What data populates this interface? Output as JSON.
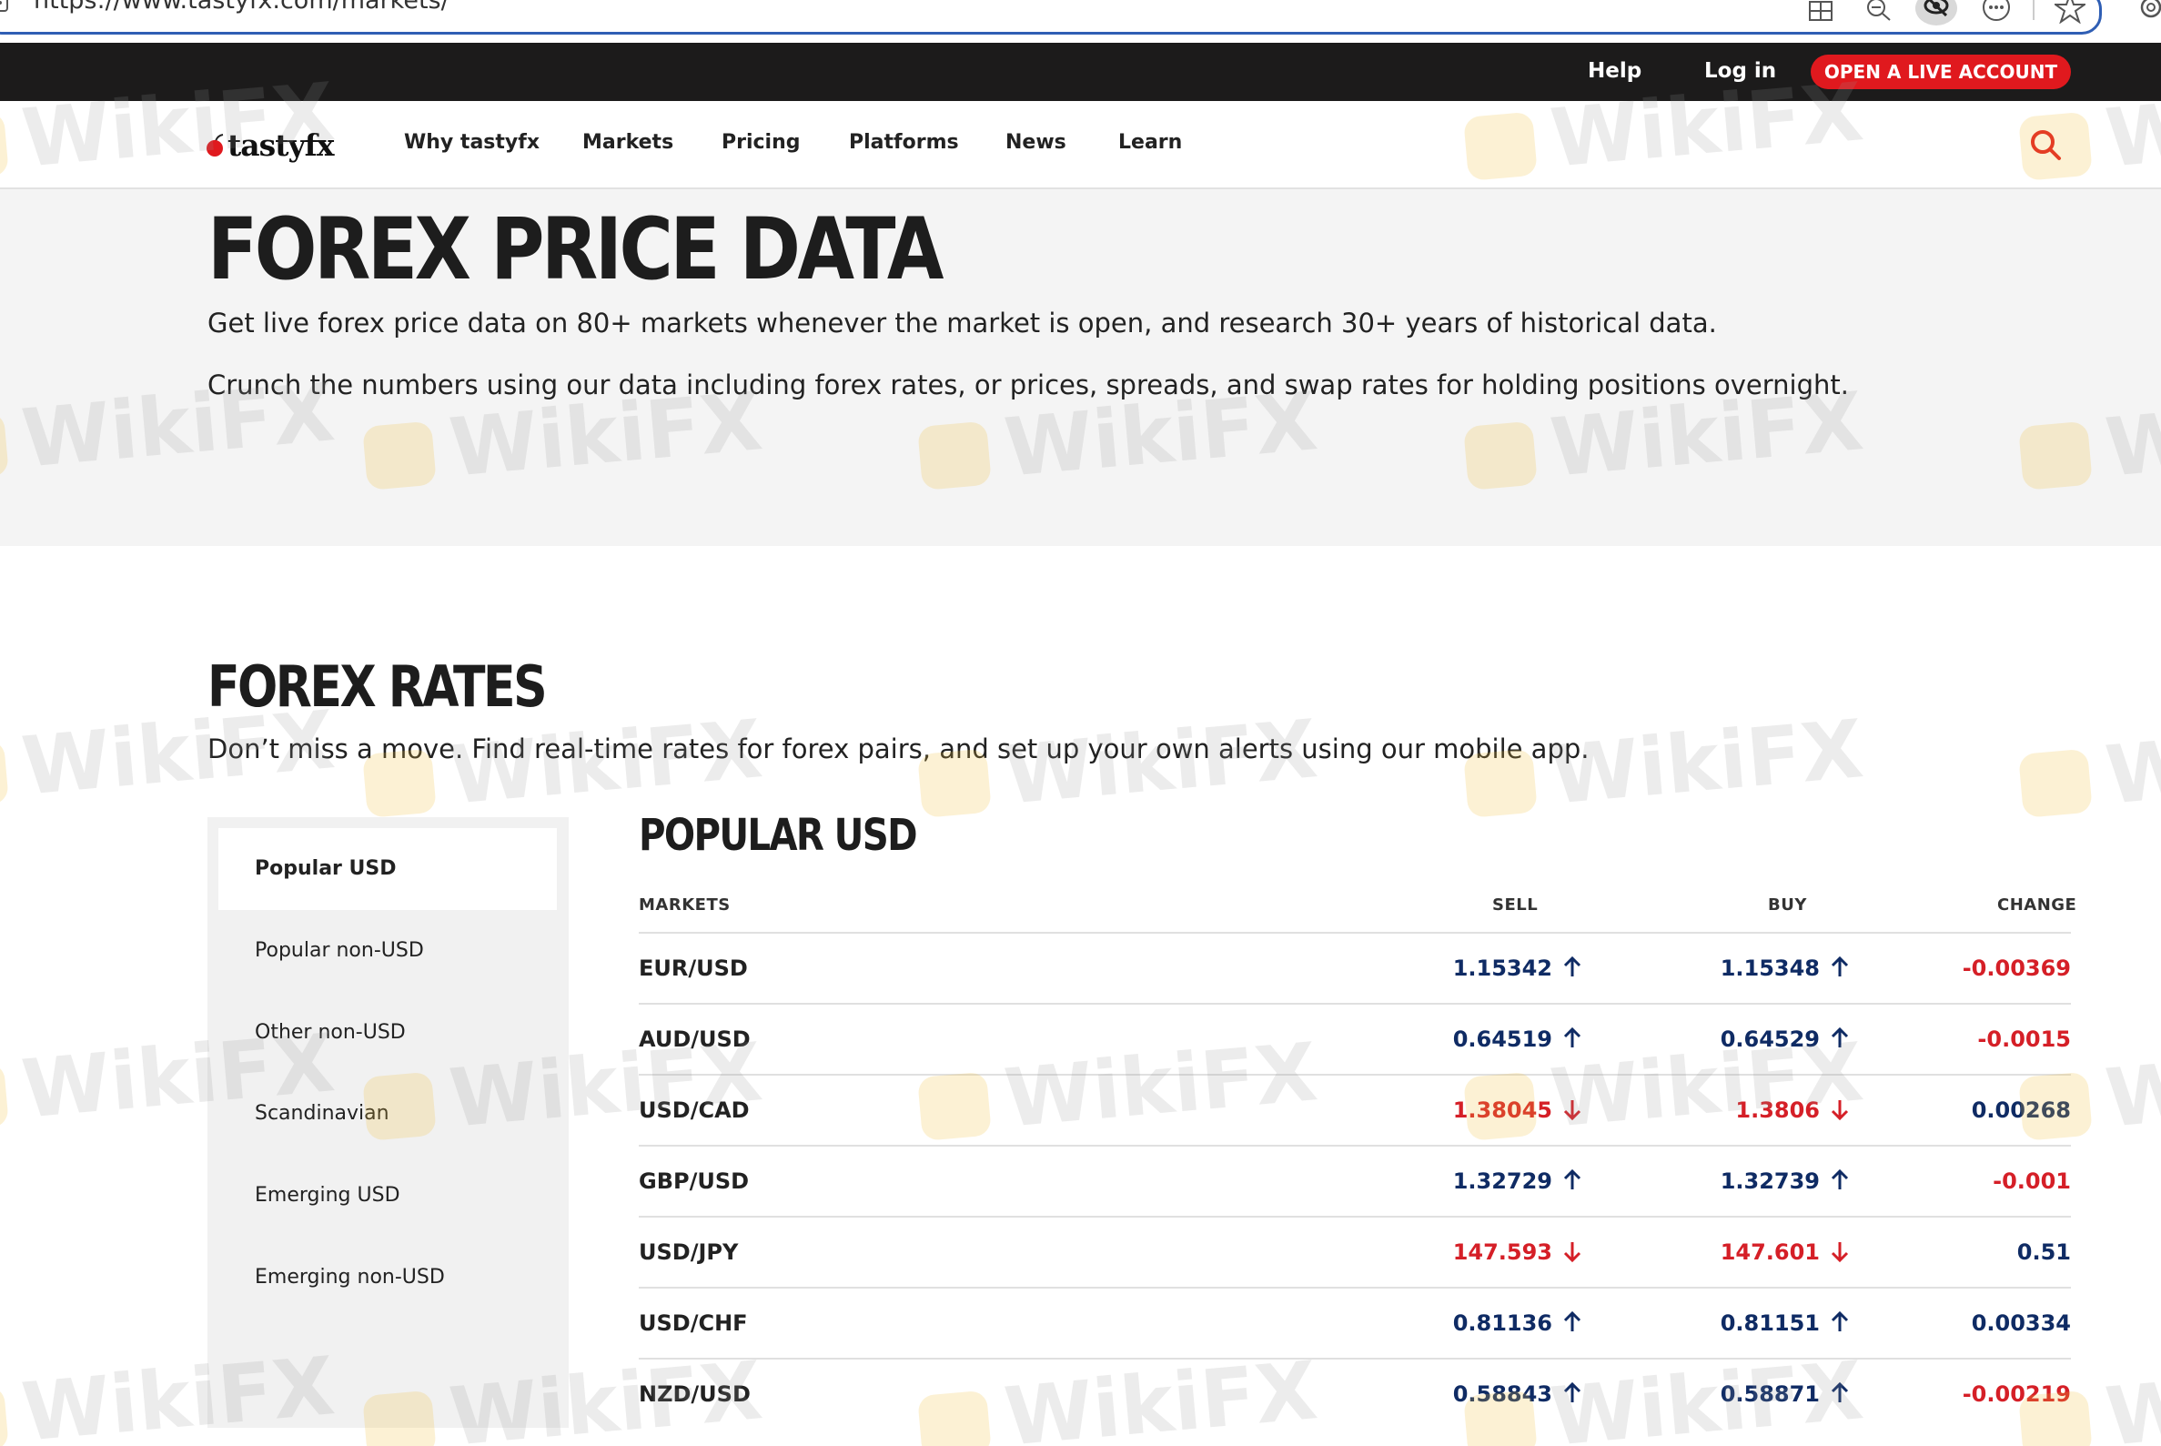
{
  "browser": {
    "url": "https://www.tastyfx.com/markets/"
  },
  "top_strip": {
    "help": "Help",
    "login": "Log in",
    "cta": "OPEN A LIVE ACCOUNT"
  },
  "nav": {
    "logo": "tastyfx",
    "items": [
      "Why tastyfx",
      "Markets",
      "Pricing",
      "Platforms",
      "News",
      "Learn"
    ]
  },
  "hero": {
    "title": "FOREX PRICE DATA",
    "p1": "Get live forex price data on 80+ markets whenever the market is open, and research 30+ years of historical data.",
    "p2": "Crunch the numbers using our data including forex rates, or prices, spreads, and swap rates for holding positions overnight."
  },
  "rates": {
    "title": "FOREX RATES",
    "subtitle": "Don’t miss a move. Find real-time rates for forex pairs, and set up your own alerts using our mobile app."
  },
  "sidebar": {
    "items": [
      "Popular USD",
      "Popular non-USD",
      "Other non-USD",
      "Scandinavian",
      "Emerging USD",
      "Emerging non-USD"
    ]
  },
  "table": {
    "title": "POPULAR USD",
    "headers": {
      "markets": "MARKETS",
      "sell": "SELL",
      "buy": "BUY",
      "change": "CHANGE"
    },
    "rows": [
      {
        "market": "EUR/USD",
        "sell": "1.15342",
        "buy": "1.15348",
        "change": "-0.00369",
        "direction": "up",
        "change_dir": "neg"
      },
      {
        "market": "AUD/USD",
        "sell": "0.64519",
        "buy": "0.64529",
        "change": "-0.0015",
        "direction": "up",
        "change_dir": "neg"
      },
      {
        "market": "USD/CAD",
        "sell": "1.38045",
        "buy": "1.3806",
        "change": "0.00268",
        "direction": "down",
        "change_dir": "pos"
      },
      {
        "market": "GBP/USD",
        "sell": "1.32729",
        "buy": "1.32739",
        "change": "-0.001",
        "direction": "up",
        "change_dir": "neg"
      },
      {
        "market": "USD/JPY",
        "sell": "147.593",
        "buy": "147.601",
        "change": "0.51",
        "direction": "down",
        "change_dir": "pos"
      },
      {
        "market": "USD/CHF",
        "sell": "0.81136",
        "buy": "0.81151",
        "change": "0.00334",
        "direction": "up",
        "change_dir": "pos"
      },
      {
        "market": "NZD/USD",
        "sell": "0.58843",
        "buy": "0.58871",
        "change": "-0.00219",
        "direction": "up",
        "change_dir": "neg"
      }
    ]
  },
  "watermark": "WikiFX",
  "colors": {
    "brand_red": "#e0191e",
    "up_blue": "#0f2b64",
    "down_red": "#d51f27",
    "top_strip": "#1c1b1b"
  }
}
